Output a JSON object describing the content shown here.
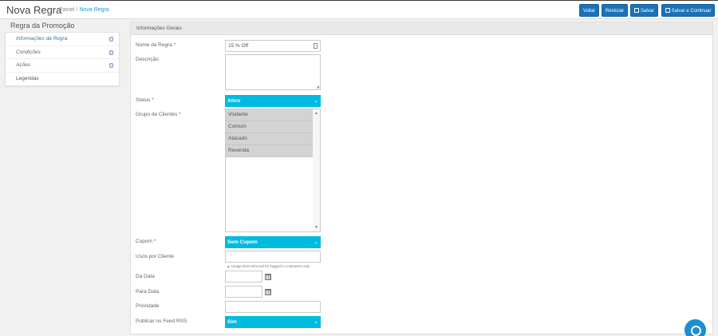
{
  "header": {
    "title": "Nova Regra",
    "breadcrumb_root": "Painel",
    "breadcrumb_separator": "/",
    "breadcrumb_current": "Nova Regra"
  },
  "toolbar": {
    "back_label": "Voltar",
    "reset_label": "Reiniciar",
    "save_label": "Salvar",
    "save_continue_label": "Salvar e Continuar"
  },
  "sidebar": {
    "title": "Regra da Promoção",
    "items": [
      {
        "label": "Informações da Regra",
        "icon": "database-icon"
      },
      {
        "label": "Condições",
        "icon": "database-icon"
      },
      {
        "label": "Ações",
        "icon": "database-icon"
      },
      {
        "label": "Legendas",
        "icon": ""
      }
    ]
  },
  "form": {
    "section_title": "Informações Gerais",
    "required_mark": "*",
    "rule_name": {
      "label": "Nome da Regra",
      "value": "15 % Off"
    },
    "description": {
      "label": "Descrição",
      "value": ""
    },
    "status": {
      "label": "Status",
      "value": "Ativo"
    },
    "customer_groups": {
      "label": "Grupo de Clientes",
      "options": [
        "Visitante",
        "Comum",
        "Atacado",
        "Revenda"
      ]
    },
    "coupon": {
      "label": "Cupom",
      "value": "Sem Cupom"
    },
    "uses_per_customer": {
      "label": "Usos por Cliente",
      "value": "",
      "hint": "▲ Usage limit enforced for logged in customers only"
    },
    "from_date": {
      "label": "Da Data",
      "value": ""
    },
    "to_date": {
      "label": "Para Data",
      "value": ""
    },
    "priority": {
      "label": "Prioridade",
      "value": ""
    },
    "rss": {
      "label": "Publicar no Feed RSS",
      "value": "Sim"
    }
  },
  "colors": {
    "button_blue": "#1a72b8",
    "select_cyan": "#00bbe0",
    "link_blue": "#1e9bd7",
    "chat_blue": "#1c8ed1"
  }
}
